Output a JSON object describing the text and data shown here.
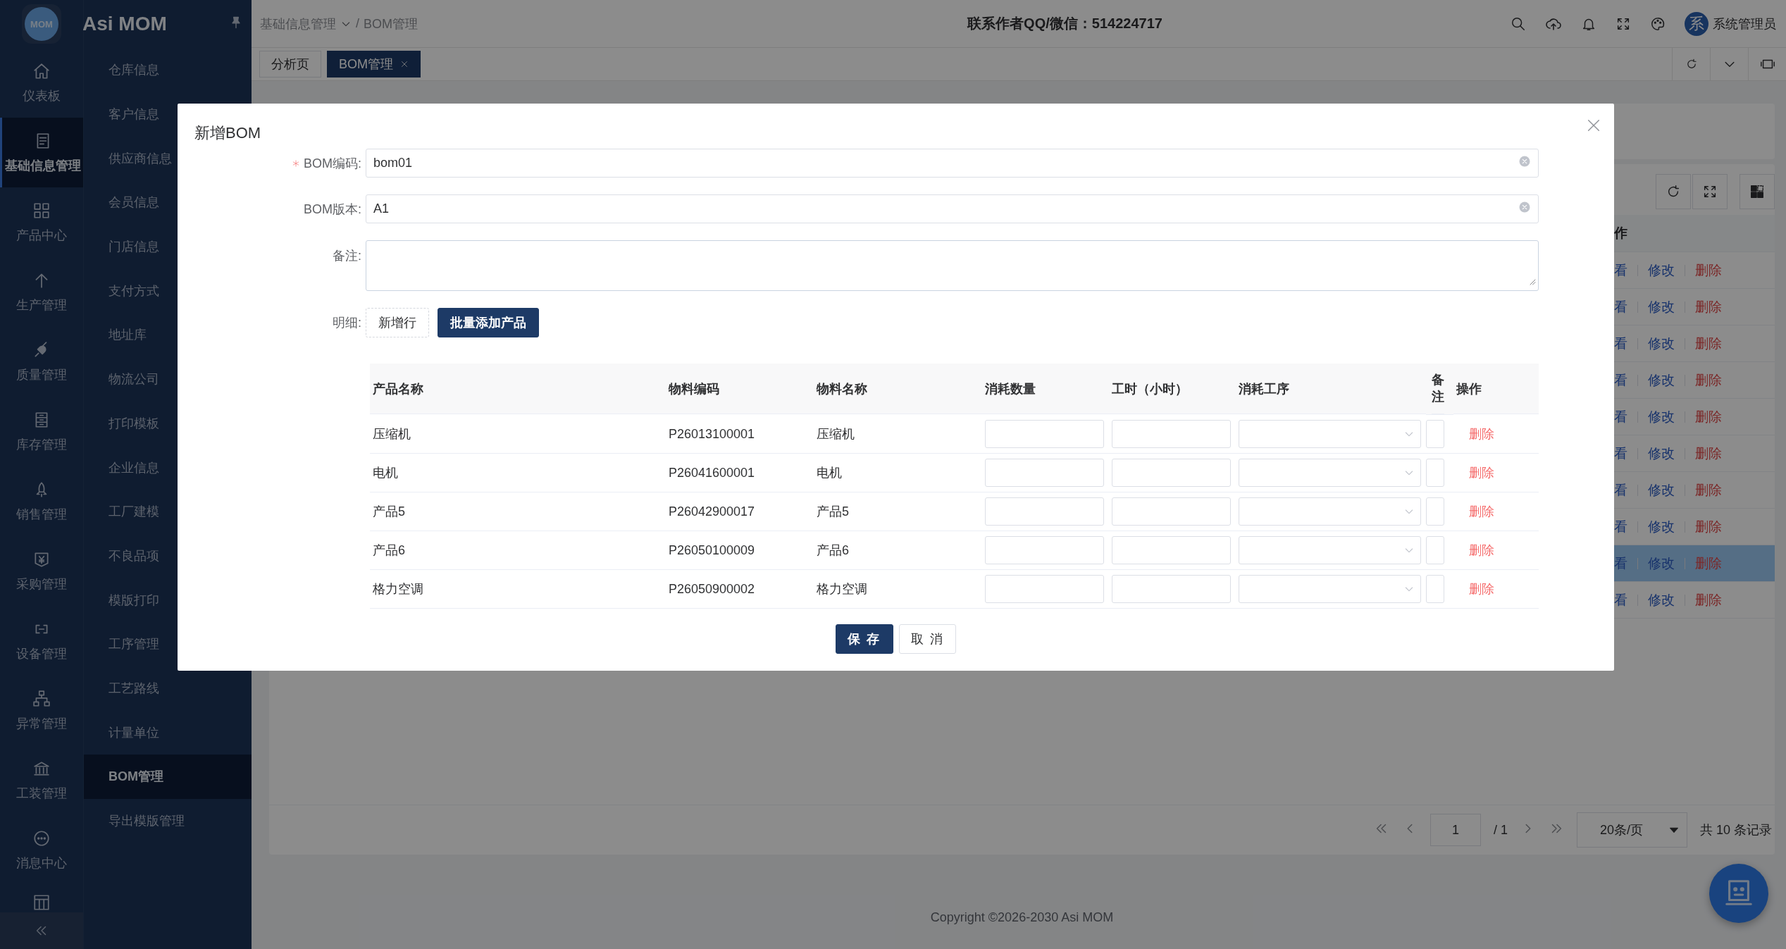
{
  "app": {
    "logo": "MOM",
    "name": "Asi MOM"
  },
  "nav": [
    {
      "label": "仪表板",
      "selected": false
    },
    {
      "label": "基础信息管理",
      "selected": true
    },
    {
      "label": "产品中心",
      "selected": false
    },
    {
      "label": "生产管理",
      "selected": false
    },
    {
      "label": "质量管理",
      "selected": false
    },
    {
      "label": "库存管理",
      "selected": false
    },
    {
      "label": "销售管理",
      "selected": false
    },
    {
      "label": "采购管理",
      "selected": false
    },
    {
      "label": "设备管理",
      "selected": false
    },
    {
      "label": "异常管理",
      "selected": false
    },
    {
      "label": "工装管理",
      "selected": false
    },
    {
      "label": "消息中心",
      "selected": false
    }
  ],
  "submenu": [
    {
      "label": "仓库信息",
      "selected": false
    },
    {
      "label": "客户信息",
      "selected": false
    },
    {
      "label": "供应商信息",
      "selected": false
    },
    {
      "label": "会员信息",
      "selected": false
    },
    {
      "label": "门店信息",
      "selected": false
    },
    {
      "label": "支付方式",
      "selected": false
    },
    {
      "label": "地址库",
      "selected": false
    },
    {
      "label": "物流公司",
      "selected": false
    },
    {
      "label": "打印模板",
      "selected": false
    },
    {
      "label": "企业信息",
      "selected": false
    },
    {
      "label": "工厂建模",
      "selected": false
    },
    {
      "label": "不良品项",
      "selected": false
    },
    {
      "label": "模版打印",
      "selected": false
    },
    {
      "label": "工序管理",
      "selected": false
    },
    {
      "label": "工艺路线",
      "selected": false
    },
    {
      "label": "计量单位",
      "selected": false
    },
    {
      "label": "BOM管理",
      "selected": true
    },
    {
      "label": "导出模版管理",
      "selected": false
    }
  ],
  "header": {
    "breadcrumb": [
      "基础信息管理",
      "BOM管理"
    ],
    "separator": "/",
    "contact": "联系作者QQ/微信：514224717",
    "user": {
      "avatar": "系",
      "name": "系统管理员"
    }
  },
  "tabs": [
    {
      "label": "分析页",
      "selected": false,
      "closable": false
    },
    {
      "label": "BOM管理",
      "selected": true,
      "closable": true
    }
  ],
  "background_table": {
    "header_fragment": "作",
    "rows": [
      {
        "view": "看",
        "edit": "修改",
        "delete": "删除",
        "selected": false
      },
      {
        "view": "看",
        "edit": "修改",
        "delete": "删除",
        "selected": false
      },
      {
        "view": "看",
        "edit": "修改",
        "delete": "删除",
        "selected": false
      },
      {
        "view": "看",
        "edit": "修改",
        "delete": "删除",
        "selected": false
      },
      {
        "view": "看",
        "edit": "修改",
        "delete": "删除",
        "selected": false
      },
      {
        "view": "看",
        "edit": "修改",
        "delete": "删除",
        "selected": false
      },
      {
        "view": "看",
        "edit": "修改",
        "delete": "删除",
        "selected": false
      },
      {
        "view": "看",
        "edit": "修改",
        "delete": "删除",
        "selected": false
      },
      {
        "view": "看",
        "edit": "修改",
        "delete": "删除",
        "selected": true
      },
      {
        "view": "看",
        "edit": "修改",
        "delete": "删除",
        "selected": false
      }
    ]
  },
  "pagination": {
    "page": "1",
    "total_pages": "/ 1",
    "page_size": "20条/页",
    "total": "共 10 条记录"
  },
  "copyright": "Copyright ©2026-2030 Asi MOM",
  "dialog": {
    "title": "新增BOM",
    "fields": [
      {
        "kind": "input",
        "label": "BOM编码:",
        "required": true,
        "value": "bom01",
        "clearable": true
      },
      {
        "kind": "input",
        "label": "BOM版本:",
        "required": false,
        "value": "A1",
        "clearable": true
      },
      {
        "kind": "textarea",
        "label": "备注:",
        "required": false
      }
    ],
    "detail": {
      "label": "明细:",
      "buttons": [
        {
          "label": "新增行",
          "kind": "dashed"
        },
        {
          "label": "批量添加产品",
          "kind": "primary"
        }
      ]
    },
    "table": {
      "columns": [
        "产品名称",
        "物料编码",
        "物料名称",
        "消耗数量",
        "工时（小时）",
        "消耗工序",
        "备注",
        "操作"
      ],
      "rows": [
        {
          "product": "压缩机",
          "code": "P26013100001",
          "material": "压缩机",
          "action": "删除"
        },
        {
          "product": "电机",
          "code": "P26041600001",
          "material": "电机",
          "action": "删除"
        },
        {
          "product": "产品5",
          "code": "P26042900017",
          "material": "产品5",
          "action": "删除"
        },
        {
          "product": "产品6",
          "code": "P26050100009",
          "material": "产品6",
          "action": "删除"
        },
        {
          "product": "格力空调",
          "code": "P26050900002",
          "material": "格力空调",
          "action": "删除"
        }
      ]
    },
    "buttons": [
      {
        "label": "保 存",
        "kind": "primary"
      },
      {
        "label": "取 消",
        "kind": "default"
      }
    ]
  }
}
